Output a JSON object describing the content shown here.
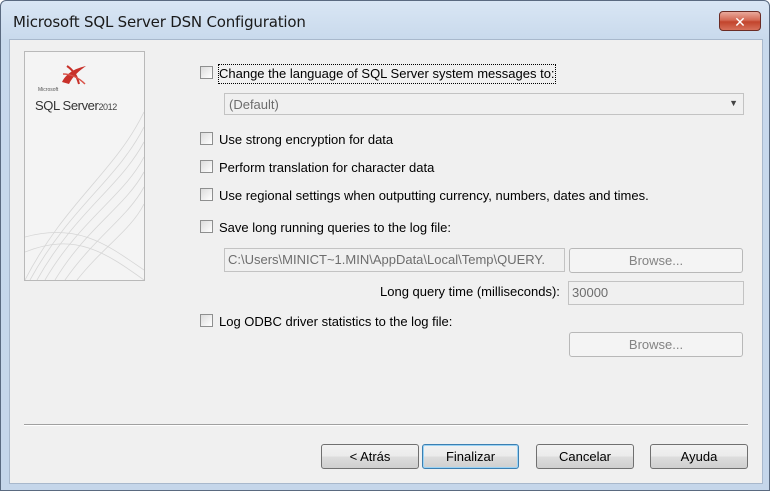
{
  "window": {
    "title": "Microsoft SQL Server DSN Configuration",
    "close_glyph": "✕"
  },
  "logo": {
    "small_text": "Microsoft",
    "product": "SQL Server",
    "year": "2012"
  },
  "options": {
    "change_language": "Change the language of SQL Server system messages to:",
    "language_value": "(Default)",
    "strong_encryption": "Use strong encryption for data",
    "translation": "Perform translation for character data",
    "regional_settings": "Use regional settings when outputting currency, numbers, dates and times.",
    "save_long_queries": "Save long running queries to the log file:",
    "long_query_path": "C:\\Users\\MINICT~1.MIN\\AppData\\Local\\Temp\\QUERY.",
    "browse1": "Browse...",
    "long_query_time_label": "Long query time (milliseconds):",
    "long_query_time_value": "30000",
    "log_odbc_stats": "Log ODBC driver statistics to the log file:",
    "browse2": "Browse..."
  },
  "buttons": {
    "back": "< Atrás",
    "finish": "Finalizar",
    "cancel": "Cancelar",
    "help": "Ayuda"
  },
  "icons": [
    "close-icon",
    "sql-server-logo-icon",
    "dropdown-arrow-icon"
  ]
}
